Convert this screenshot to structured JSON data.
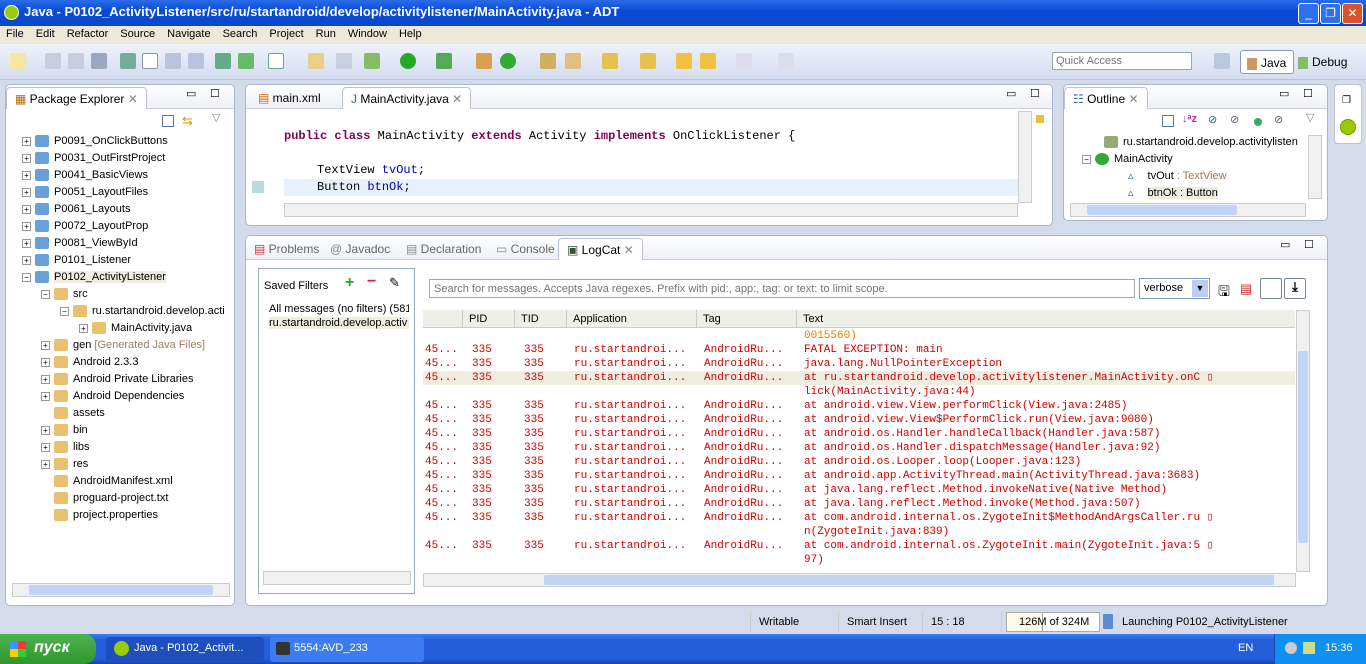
{
  "window": {
    "title": "Java - P0102_ActivityListener/src/ru/startandroid/develop/activitylistener/MainActivity.java - ADT",
    "minimize": "_",
    "restore": "❐",
    "close": "✕"
  },
  "menu": [
    "File",
    "Edit",
    "Refactor",
    "Source",
    "Navigate",
    "Search",
    "Project",
    "Run",
    "Window",
    "Help"
  ],
  "toolbar": {
    "quick_access_placeholder": "Quick Access",
    "perspectives": [
      "Java",
      "Debug"
    ]
  },
  "package_explorer": {
    "title": "Package Explorer",
    "items": [
      {
        "label": "P0091_OnClickButtons",
        "level": 0,
        "expander": "+"
      },
      {
        "label": "P0031_OutFirstProject",
        "level": 0,
        "expander": "+"
      },
      {
        "label": "P0041_BasicViews",
        "level": 0,
        "expander": "+"
      },
      {
        "label": "P0051_LayoutFiles",
        "level": 0,
        "expander": "+"
      },
      {
        "label": "P0061_Layouts",
        "level": 0,
        "expander": "+"
      },
      {
        "label": "P0072_LayoutProp",
        "level": 0,
        "expander": "+"
      },
      {
        "label": "P0081_ViewById",
        "level": 0,
        "expander": "+"
      },
      {
        "label": "P0101_Listener",
        "level": 0,
        "expander": "+"
      },
      {
        "label": "P0102_ActivityListener",
        "level": 0,
        "expander": "−",
        "selected": true
      },
      {
        "label": "src",
        "level": 1,
        "expander": "−"
      },
      {
        "label": "ru.startandroid.develop.acti",
        "level": 2,
        "expander": "−"
      },
      {
        "label": "MainActivity.java",
        "level": 3,
        "expander": "+"
      },
      {
        "label": "gen",
        "suffix": " [Generated Java Files]",
        "level": 1,
        "expander": "+"
      },
      {
        "label": "Android 2.3.3",
        "level": 1,
        "expander": "+"
      },
      {
        "label": "Android Private Libraries",
        "level": 1,
        "expander": "+"
      },
      {
        "label": "Android Dependencies",
        "level": 1,
        "expander": "+"
      },
      {
        "label": "assets",
        "level": 1,
        "expander": ""
      },
      {
        "label": "bin",
        "level": 1,
        "expander": "+"
      },
      {
        "label": "libs",
        "level": 1,
        "expander": "+"
      },
      {
        "label": "res",
        "level": 1,
        "expander": "+"
      },
      {
        "label": "AndroidManifest.xml",
        "level": 1,
        "expander": ""
      },
      {
        "label": "proguard-project.txt",
        "level": 1,
        "expander": ""
      },
      {
        "label": "project.properties",
        "level": 1,
        "expander": ""
      }
    ]
  },
  "editor": {
    "tabs": [
      "main.xml",
      "MainActivity.java"
    ],
    "active_tab": 1,
    "line1": {
      "k1": "public class",
      "n1": " MainActivity ",
      "k2": "extends",
      "n2": " Activity ",
      "k3": "implements",
      "n3": " OnClickListener {"
    },
    "line2": {
      "t": "TextView ",
      "f": "tvOut",
      "e": ";"
    },
    "line3": {
      "t": "Button ",
      "f": "btnOk",
      "e": ";"
    }
  },
  "outline": {
    "title": "Outline",
    "items": [
      {
        "label": "ru.startandroid.develop.activitylisten",
        "type": ""
      },
      {
        "label": "MainActivity",
        "type": ""
      },
      {
        "label": "tvOut",
        "type": " : TextView"
      },
      {
        "label": "btnOk",
        "type": " : Button"
      }
    ]
  },
  "bottom": {
    "tabs": [
      "Problems",
      "Javadoc",
      "Declaration",
      "Console",
      "LogCat"
    ],
    "active_tab": "LogCat",
    "saved_filters": {
      "title": "Saved Filters",
      "items": [
        "All messages (no filters) (581",
        "ru.startandroid.develop.activ"
      ]
    },
    "search_placeholder": "Search for messages. Accepts Java regexes. Prefix with pid:, app:, tag: or text: to limit scope.",
    "level": "verbose",
    "columns": [
      "PID",
      "TID",
      "Application",
      "Tag",
      "Text"
    ],
    "rows": [
      {
        "lvl": "",
        "pid": "",
        "tid": "",
        "app": "",
        "tag": "",
        "text": "0015560)",
        "color": "#e08000"
      },
      {
        "lvl": "45...",
        "pid": "335",
        "tid": "335",
        "app": "ru.startandroi...",
        "tag": "AndroidRu...",
        "text": "FATAL EXCEPTION: main"
      },
      {
        "lvl": "45...",
        "pid": "335",
        "tid": "335",
        "app": "ru.startandroi...",
        "tag": "AndroidRu...",
        "text": "java.lang.NullPointerException"
      },
      {
        "lvl": "45...",
        "pid": "335",
        "tid": "335",
        "app": "ru.startandroi...",
        "tag": "AndroidRu...",
        "text": "at ru.startandroid.develop.activitylistener.MainActivity.onC ▯",
        "selected": true
      },
      {
        "lvl": "",
        "pid": "",
        "tid": "",
        "app": "",
        "tag": "",
        "text": "lick(MainActivity.java:44)"
      },
      {
        "lvl": "45...",
        "pid": "335",
        "tid": "335",
        "app": "ru.startandroi...",
        "tag": "AndroidRu...",
        "text": "at android.view.View.performClick(View.java:2485)"
      },
      {
        "lvl": "45...",
        "pid": "335",
        "tid": "335",
        "app": "ru.startandroi...",
        "tag": "AndroidRu...",
        "text": "at android.view.View$PerformClick.run(View.java:9080)"
      },
      {
        "lvl": "45...",
        "pid": "335",
        "tid": "335",
        "app": "ru.startandroi...",
        "tag": "AndroidRu...",
        "text": "at android.os.Handler.handleCallback(Handler.java:587)"
      },
      {
        "lvl": "45...",
        "pid": "335",
        "tid": "335",
        "app": "ru.startandroi...",
        "tag": "AndroidRu...",
        "text": "at android.os.Handler.dispatchMessage(Handler.java:92)"
      },
      {
        "lvl": "45...",
        "pid": "335",
        "tid": "335",
        "app": "ru.startandroi...",
        "tag": "AndroidRu...",
        "text": "at android.os.Looper.loop(Looper.java:123)"
      },
      {
        "lvl": "45...",
        "pid": "335",
        "tid": "335",
        "app": "ru.startandroi...",
        "tag": "AndroidRu...",
        "text": "at android.app.ActivityThread.main(ActivityThread.java:3683)"
      },
      {
        "lvl": "45...",
        "pid": "335",
        "tid": "335",
        "app": "ru.startandroi...",
        "tag": "AndroidRu...",
        "text": "at java.lang.reflect.Method.invokeNative(Native Method)"
      },
      {
        "lvl": "45...",
        "pid": "335",
        "tid": "335",
        "app": "ru.startandroi...",
        "tag": "AndroidRu...",
        "text": "at java.lang.reflect.Method.invoke(Method.java:507)"
      },
      {
        "lvl": "45...",
        "pid": "335",
        "tid": "335",
        "app": "ru.startandroi...",
        "tag": "AndroidRu...",
        "text": "at com.android.internal.os.ZygoteInit$MethodAndArgsCaller.ru ▯"
      },
      {
        "lvl": "",
        "pid": "",
        "tid": "",
        "app": "",
        "tag": "",
        "text": "n(ZygoteInit.java:839)"
      },
      {
        "lvl": "45...",
        "pid": "335",
        "tid": "335",
        "app": "ru.startandroi...",
        "tag": "AndroidRu...",
        "text": "at com.android.internal.os.ZygoteInit.main(ZygoteInit.java:5 ▯"
      },
      {
        "lvl": "",
        "pid": "",
        "tid": "",
        "app": "",
        "tag": "",
        "text": "97)"
      }
    ]
  },
  "status": {
    "writable": "Writable",
    "insert": "Smart Insert",
    "position": "15 : 18",
    "heap": "126M of 324M",
    "heap_used_fraction": 0.39,
    "job": "Launching P0102_ActivityListener"
  },
  "taskbar": {
    "start": "пуск",
    "tasks": [
      "Java - P0102_Activit...",
      "5554:AVD_233"
    ],
    "lang": "EN",
    "clock": "15:36"
  },
  "colors": {
    "log_error": "#d00000",
    "accent": "#245edb"
  }
}
